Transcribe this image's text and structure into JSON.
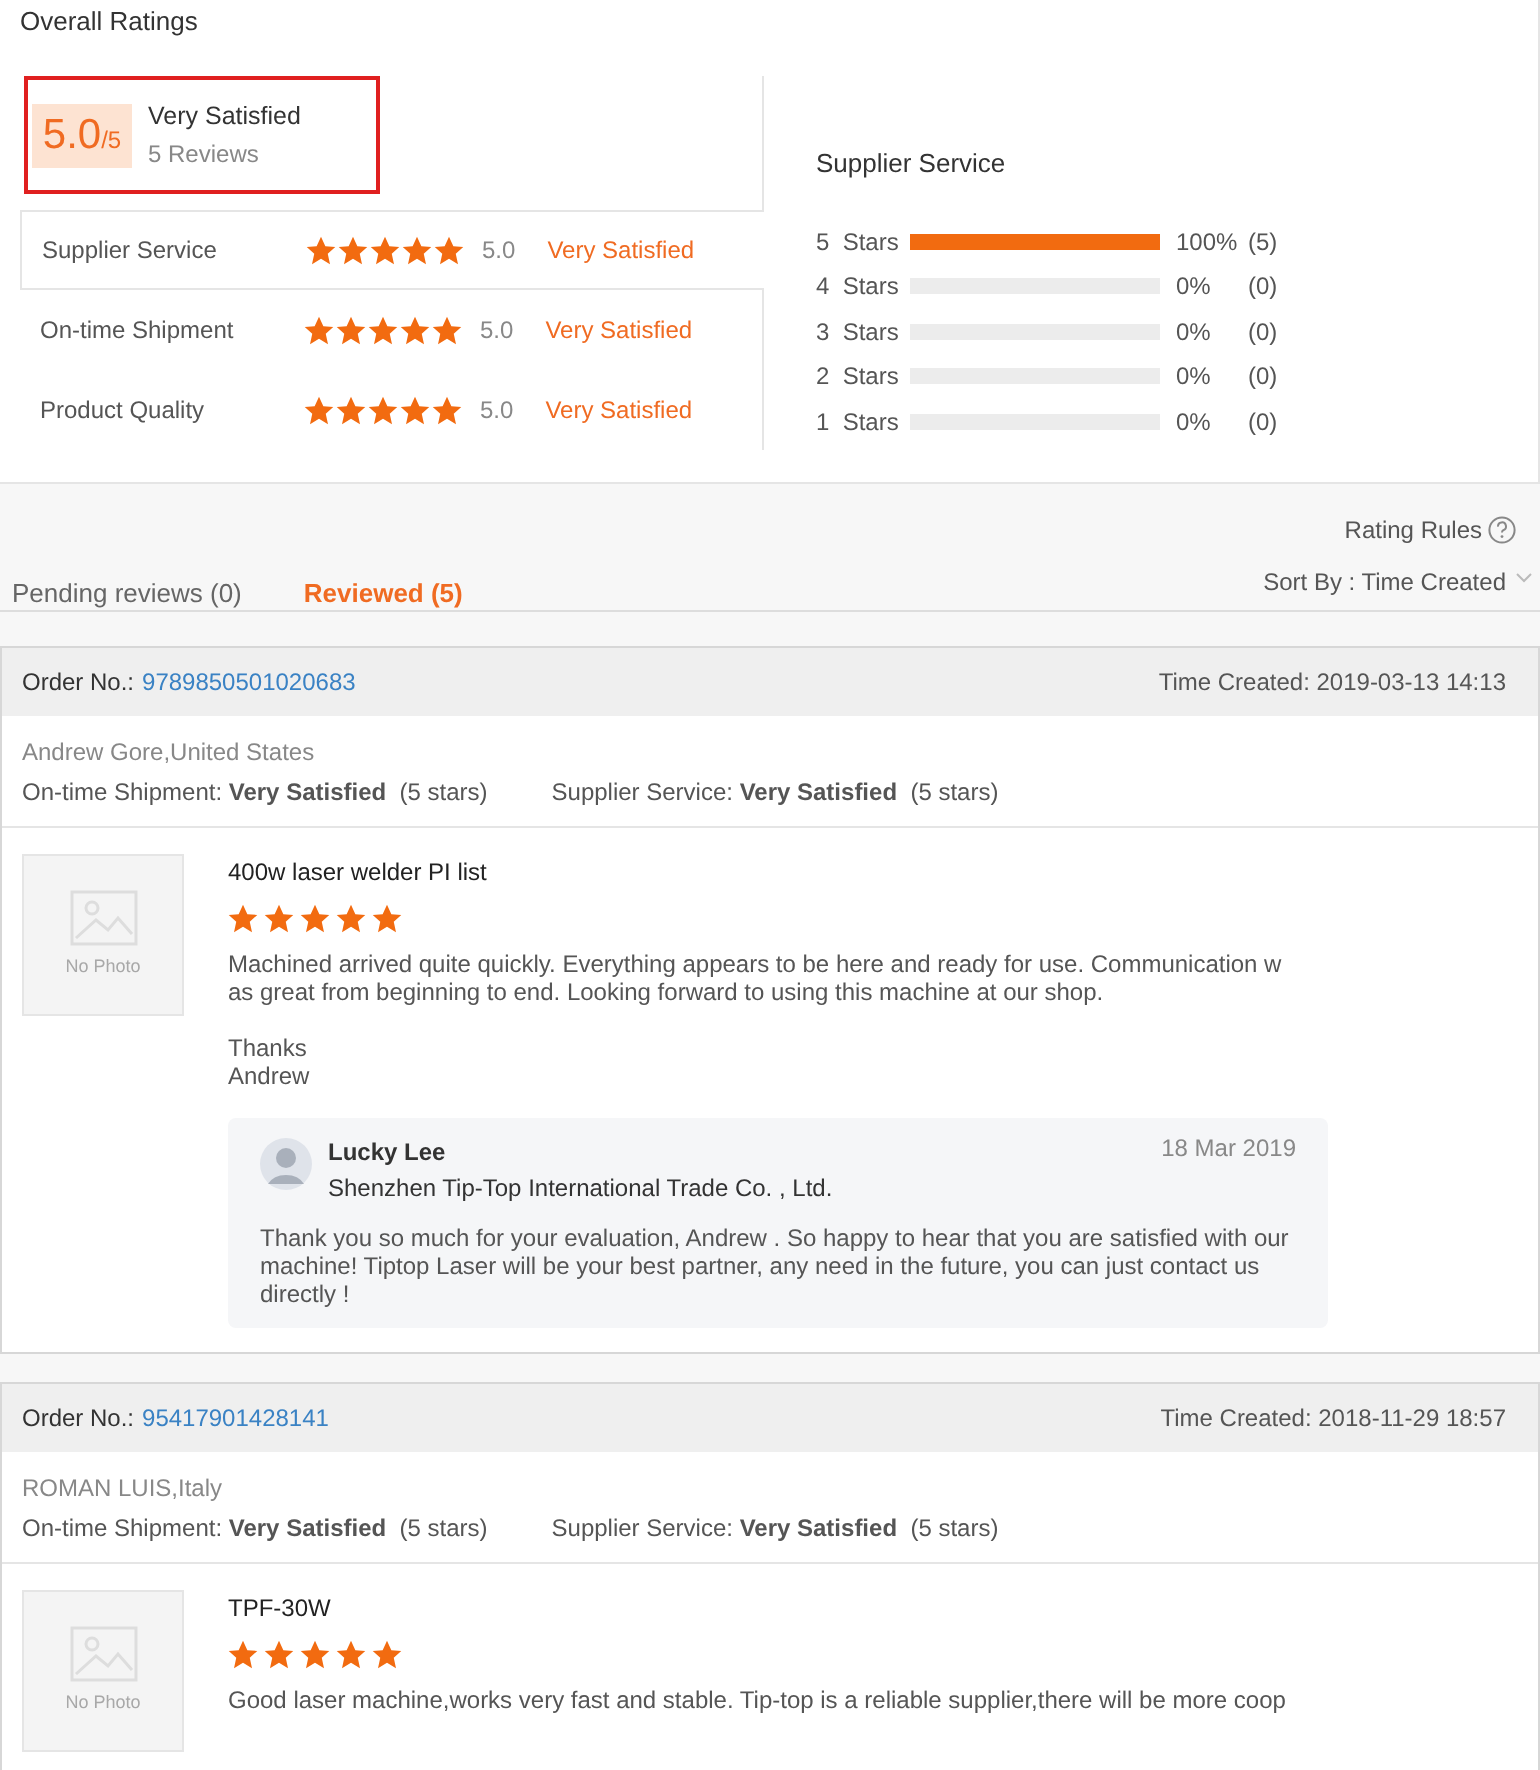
{
  "title": "Overall Ratings",
  "summary": {
    "score": "5.0",
    "out_of": "/5",
    "label": "Very Satisfied",
    "reviews": "5 Reviews"
  },
  "ratings": [
    {
      "name": "Supplier Service",
      "stars": 5,
      "score": "5.0",
      "verdict": "Very Satisfied",
      "selected": true
    },
    {
      "name": "On-time Shipment",
      "stars": 5,
      "score": "5.0",
      "verdict": "Very Satisfied",
      "selected": false
    },
    {
      "name": "Product Quality",
      "stars": 5,
      "score": "5.0",
      "verdict": "Very Satisfied",
      "selected": false
    }
  ],
  "distribution": {
    "title": "Supplier Service",
    "rows": [
      {
        "label": "5  Stars",
        "level": 1,
        "percent": "100%",
        "count": "(5)"
      },
      {
        "label": "4  Stars",
        "level": 0,
        "percent": "0%",
        "count": "(0)"
      },
      {
        "label": "3  Stars",
        "level": 0,
        "percent": "0%",
        "count": "(0)"
      },
      {
        "label": "2  Stars",
        "level": 0,
        "percent": "0%",
        "count": "(0)"
      },
      {
        "label": "1  Stars",
        "level": 0,
        "percent": "0%",
        "count": "(0)"
      }
    ]
  },
  "rating_rules": "Rating Rules",
  "tabs": [
    {
      "label": "Pending reviews (0)",
      "selected": false
    },
    {
      "label": "Reviewed (5)",
      "selected": true
    }
  ],
  "sort": {
    "label": "Sort By : Time Created"
  },
  "reviews": [
    {
      "order_label": "Order No.:",
      "order_no": "9789850501020683",
      "time": "Time Created: 2019-03-13 14:13",
      "buyer": "Andrew Gore,United States",
      "ratings": [
        {
          "name": "On-time Shipment:",
          "verdict": "Very Satisfied",
          "note": "(5 stars)"
        },
        {
          "name": "Supplier Service:",
          "verdict": "Very Satisfied",
          "note": "(5 stars)"
        }
      ],
      "photo": "No Photo",
      "product": "400w laser welder PI list",
      "stars": 5,
      "paragraphs": [
        "Machined arrived quite quickly.  Everything appears to be here and ready for use.  Communication w\nas great from beginning to end.  Looking forward to using this machine at our shop.",
        "Thanks\nAndrew"
      ],
      "reply": {
        "name": "Lucky Lee",
        "company": "Shenzhen Tip-Top International Trade Co. , Ltd.",
        "date": "18 Mar 2019",
        "text": "Thank you so much for your evaluation, Andrew . So happy to hear that you are satisfied with our machine! Tiptop Laser will be your best partner, any need in the future, you can just contact us directly !"
      }
    },
    {
      "order_label": "Order No.:",
      "order_no": "95417901428141",
      "time": "Time Created: 2018-11-29 18:57",
      "buyer": "ROMAN LUIS,Italy",
      "ratings": [
        {
          "name": "On-time Shipment:",
          "verdict": "Very Satisfied",
          "note": "(5 stars)"
        },
        {
          "name": "Supplier Service:",
          "verdict": "Very Satisfied",
          "note": "(5 stars)"
        }
      ],
      "photo": "No Photo",
      "product": "TPF-30W",
      "stars": 5,
      "paragraphs": [
        "Good laser machine,works very fast and stable. Tip-top is a reliable supplier,there will be more coop"
      ]
    }
  ]
}
